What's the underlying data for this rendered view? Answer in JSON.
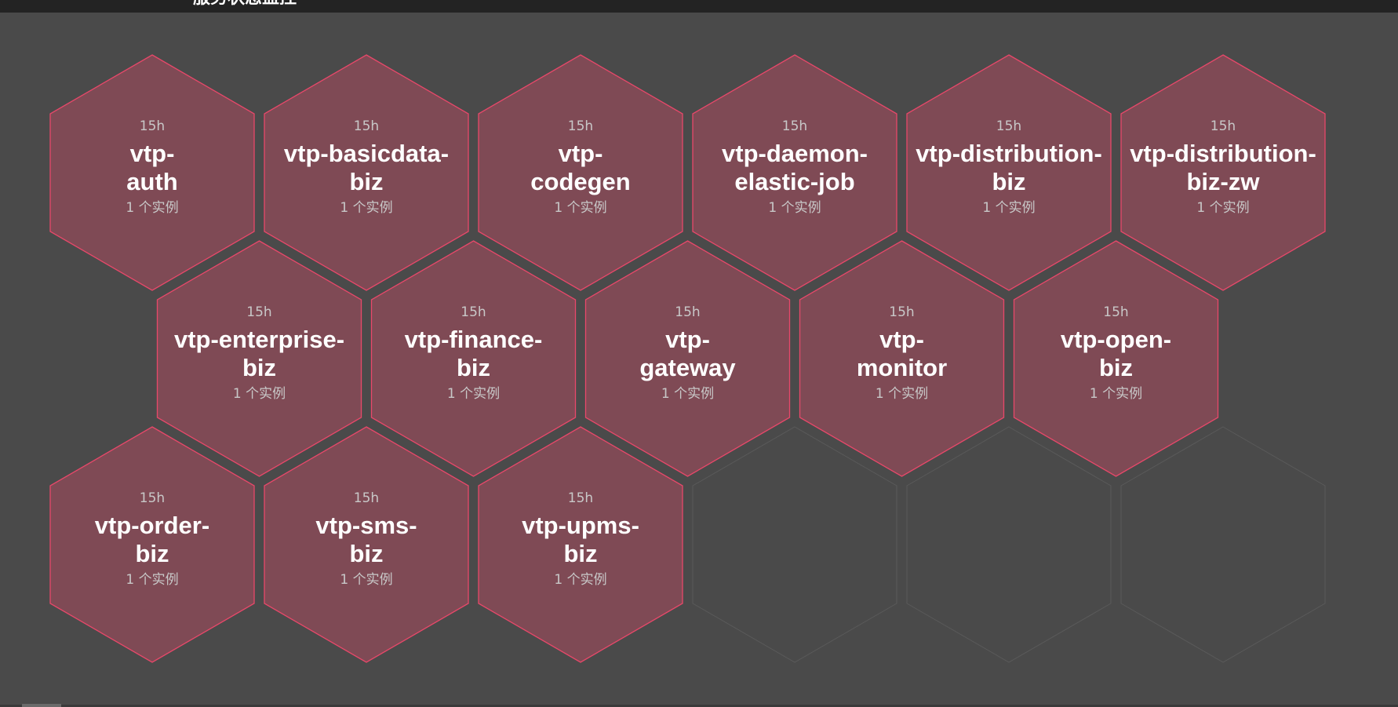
{
  "header": {
    "title": "服务状态监控"
  },
  "colors": {
    "background": "#4a4a4a",
    "topbar": "#232323",
    "hex_fill": "#7f4a55",
    "hex_stroke": "#e8486a",
    "empty_stroke": "#5a5a5a"
  },
  "services": [
    {
      "age": "15h",
      "name": [
        "vtp-",
        "auth"
      ],
      "instances": "1 个实例"
    },
    {
      "age": "15h",
      "name": [
        "vtp-basicdata-",
        "biz"
      ],
      "instances": "1 个实例"
    },
    {
      "age": "15h",
      "name": [
        "vtp-",
        "codegen"
      ],
      "instances": "1 个实例"
    },
    {
      "age": "15h",
      "name": [
        "vtp-daemon-",
        "elastic-job"
      ],
      "instances": "1 个实例"
    },
    {
      "age": "15h",
      "name": [
        "vtp-distribution-",
        "biz"
      ],
      "instances": "1 个实例"
    },
    {
      "age": "15h",
      "name": [
        "vtp-distribution-",
        "biz-zw"
      ],
      "instances": "1 个实例"
    },
    {
      "age": "15h",
      "name": [
        "vtp-enterprise-",
        "biz"
      ],
      "instances": "1 个实例"
    },
    {
      "age": "15h",
      "name": [
        "vtp-finance-",
        "biz"
      ],
      "instances": "1 个实例"
    },
    {
      "age": "15h",
      "name": [
        "vtp-",
        "gateway"
      ],
      "instances": "1 个实例"
    },
    {
      "age": "15h",
      "name": [
        "vtp-",
        "monitor"
      ],
      "instances": "1 个实例"
    },
    {
      "age": "15h",
      "name": [
        "vtp-open-",
        "biz"
      ],
      "instances": "1 个实例"
    },
    {
      "age": "15h",
      "name": [
        "vtp-order-",
        "biz"
      ],
      "instances": "1 个实例"
    },
    {
      "age": "15h",
      "name": [
        "vtp-sms-",
        "biz"
      ],
      "instances": "1 个实例"
    },
    {
      "age": "15h",
      "name": [
        "vtp-upms-",
        "biz"
      ],
      "instances": "1 个实例"
    }
  ],
  "empty_slots": 3
}
